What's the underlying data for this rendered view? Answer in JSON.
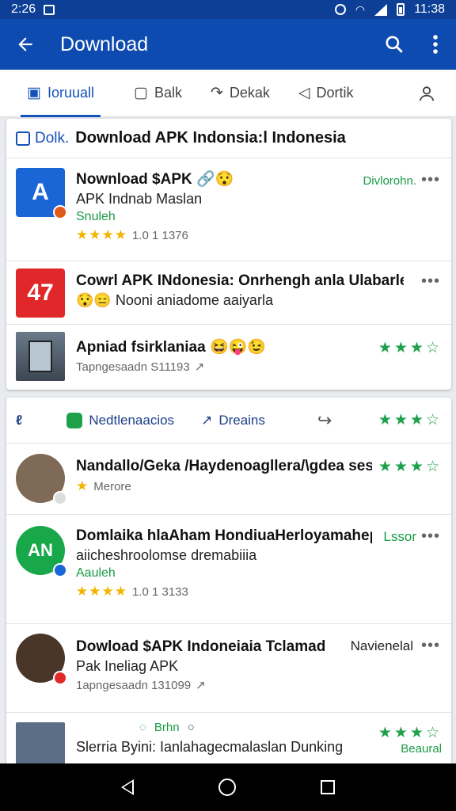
{
  "status_bar": {
    "time": "2:26",
    "clock": "11:38"
  },
  "app_bar": {
    "title": "Download"
  },
  "tabs": [
    {
      "label": "Ioruuall",
      "icon": "chat-icon"
    },
    {
      "label": "Balk",
      "icon": "message-icon"
    },
    {
      "label": "Dekak",
      "icon": "share-icon"
    },
    {
      "label": "Dortik",
      "icon": "navigation-icon"
    }
  ],
  "section1": {
    "prefix": "Dolk.",
    "title": "Download APK Indonsia:l Indonesia",
    "rows": [
      {
        "title": "Nownload $APK",
        "title_emoji": "🔗😯",
        "subtitle": "APK Indnab Maslan",
        "tag": "Snuleh",
        "stars": "★★★★",
        "rating": "1.0 1 1376",
        "side_label": "Divlorohn.",
        "thumb_letter": "A",
        "thumb_color": "#1b66d6"
      },
      {
        "title": "Cowrl APK INdonesia: Onrhengh anla Ulabarlelah",
        "subtitle": "😯😑 Nooni aniadome aaiyarla",
        "thumb_letter": "47",
        "thumb_color": "#e0282a"
      },
      {
        "title": "Apniad fsirklaniaa",
        "title_emoji": "😆😜😉",
        "meta": "Tapngesaadn S11193",
        "stars": "★★★☆"
      }
    ]
  },
  "section2": {
    "subtabs": [
      {
        "label": "Nedtlenaacios"
      },
      {
        "label": "Dreains"
      }
    ],
    "header_stars": "★★★☆",
    "rows": [
      {
        "title": "Nandallo/Geka /Haydenoagllera/\\gdea ses",
        "meta_stars": "★",
        "meta": "Merore",
        "stars": "★★★☆"
      },
      {
        "title": "Domlaika hlaAham HondiuaHerloyamahepia.",
        "title_tail": "Lssor",
        "subtitle": "aiicheshroolomse dremabiiia",
        "tag": "Aauleh",
        "stars": "★★★★",
        "rating": "1.0 1 3133",
        "thumb_text": "AN",
        "thumb_color": "#18a84a"
      },
      {
        "title": "Dowload $APK Indoneiaia Tclamad",
        "title_emoji": "😯😉",
        "title_tail": "Navienelal",
        "subtitle": "Pak Ineliag APK",
        "meta": "1apngesaadn 131099"
      },
      {
        "title": "Slerria Byini: Ianlahagecmalaslan Dunking",
        "overlay_label": "Brhn",
        "stars": "★★★☆",
        "side_label": "Beaural"
      }
    ]
  }
}
